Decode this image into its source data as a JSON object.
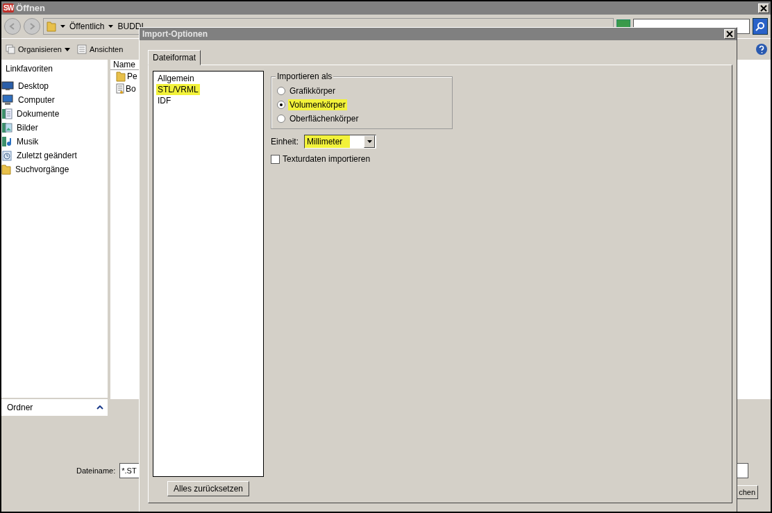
{
  "window": {
    "title": "Öffnen",
    "logo_text": "SW"
  },
  "address_bar": {
    "segments": [
      "Öffentlich",
      "BUDDI"
    ]
  },
  "toolbar": [
    {
      "label": "Organisieren",
      "dropdown": true
    },
    {
      "label": "Ansichten",
      "dropdown": false
    }
  ],
  "sidebar": {
    "heading": "Linkfavoriten",
    "items": [
      {
        "label": "Desktop",
        "kind": "desktop"
      },
      {
        "label": "Computer",
        "kind": "computer"
      },
      {
        "label": "Dokumente",
        "kind": "documents"
      },
      {
        "label": "Bilder",
        "kind": "pictures"
      },
      {
        "label": "Musik",
        "kind": "music"
      },
      {
        "label": "Zuletzt geändert",
        "kind": "recent"
      },
      {
        "label": "Suchvorgänge",
        "kind": "folder"
      }
    ],
    "footer": "Ordner"
  },
  "file_list": {
    "columns": [
      "Name"
    ],
    "rows": [
      {
        "label": "Pe",
        "kind": "folder"
      },
      {
        "label": "Bo",
        "kind": "document"
      }
    ]
  },
  "filename": {
    "label": "Dateiname:",
    "value": "*.ST"
  },
  "buttons": [
    "chen"
  ],
  "dialog": {
    "title": "Import-Optionen",
    "tabs": [
      {
        "label": "Dateiformat",
        "selected": true
      }
    ],
    "categories": [
      {
        "label": "Allgemein",
        "highlighted": false
      },
      {
        "label": "STL/VRML",
        "highlighted": true
      },
      {
        "label": "IDF",
        "highlighted": false
      }
    ],
    "import_as": {
      "title": "Importieren als",
      "options": [
        {
          "label": "Grafikkörper",
          "selected": false,
          "highlighted": false
        },
        {
          "label": "Volumenkörper",
          "selected": true,
          "highlighted": true
        },
        {
          "label": "Oberflächenkörper",
          "selected": false,
          "highlighted": false
        }
      ]
    },
    "unit": {
      "label": "Einheit:",
      "value": "Millimeter",
      "highlighted": true
    },
    "texture": {
      "label": "Texturdaten importieren",
      "checked": false
    },
    "reset_button": "Alles zurücksetzen"
  }
}
